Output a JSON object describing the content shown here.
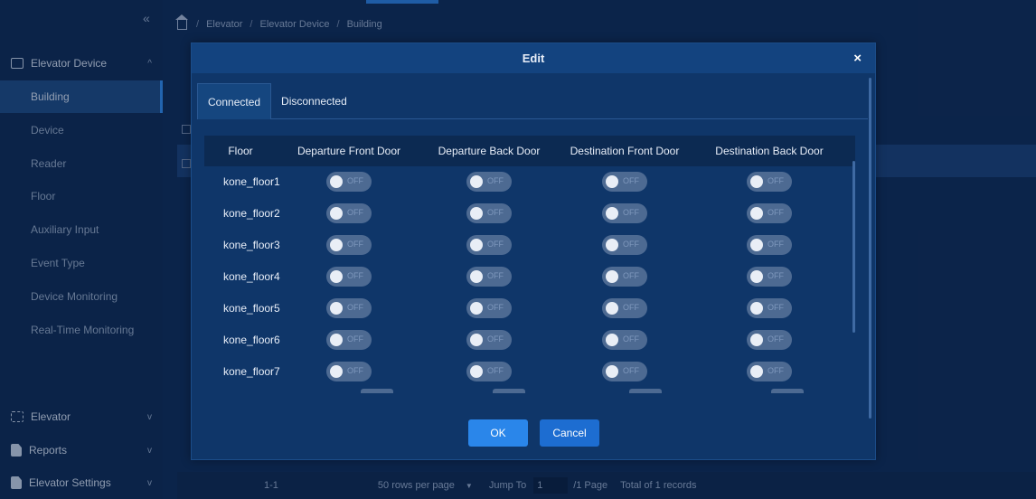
{
  "sidebar": {
    "collapse_glyph": "«",
    "groups": {
      "elevator_device": "Elevator Device",
      "elevator": "Elevator",
      "reports": "Reports",
      "elevator_settings": "Elevator Settings"
    },
    "items": [
      {
        "label": "Building",
        "active": true
      },
      {
        "label": "Device"
      },
      {
        "label": "Reader"
      },
      {
        "label": "Floor"
      },
      {
        "label": "Auxiliary Input"
      },
      {
        "label": "Event Type"
      },
      {
        "label": "Device Monitoring"
      },
      {
        "label": "Real-Time Monitoring"
      }
    ],
    "icons": [
      "elevator-device-icon",
      "elevator-icon",
      "reports-icon",
      "elevator-settings-icon"
    ]
  },
  "breadcrumb": [
    "Elevator",
    "Elevator Device",
    "Building"
  ],
  "pagination": {
    "range": "1-1",
    "rows_per_page": "50 rows per page",
    "jump_to": "Jump To",
    "jump_value": "1",
    "pages": "/1 Page",
    "total": "Total of 1 records"
  },
  "modal": {
    "title": "Edit",
    "close": "×",
    "tabs": [
      {
        "label": "Connected",
        "active": true
      },
      {
        "label": "Disconnected",
        "active": false
      }
    ],
    "columns": [
      "Floor",
      "Departure Front Door",
      "Departure Back Door",
      "Destination Front Door",
      "Destination Back Door"
    ],
    "toggle_off_label": "OFF",
    "rows": [
      {
        "floor": "kone_floor1"
      },
      {
        "floor": "kone_floor2"
      },
      {
        "floor": "kone_floor3"
      },
      {
        "floor": "kone_floor4"
      },
      {
        "floor": "kone_floor5"
      },
      {
        "floor": "kone_floor6"
      },
      {
        "floor": "kone_floor7"
      }
    ],
    "ok_label": "OK",
    "cancel_label": "Cancel"
  },
  "colors": {
    "accent": "#2a86ea",
    "sidebar_bg": "#0e2c58",
    "modal_bg": "#0f3669",
    "toggle_off": "#4d6a92"
  }
}
